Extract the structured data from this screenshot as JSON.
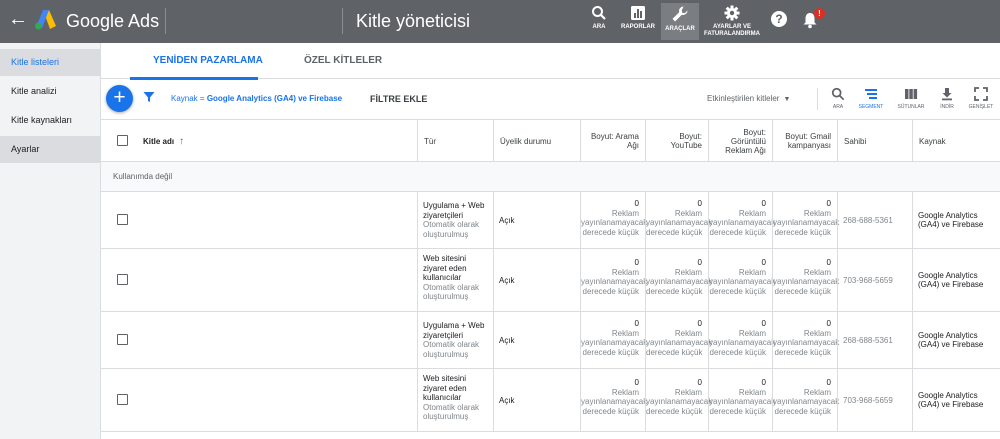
{
  "header": {
    "brand": "Google Ads",
    "page_title": "Kitle yöneticisi",
    "tools": [
      {
        "icon": "search-icon",
        "label": "ARA"
      },
      {
        "icon": "reports-icon",
        "label": "RAPORLAR"
      },
      {
        "icon": "wrench-icon",
        "label": "ARAÇLAR"
      },
      {
        "icon": "settings-icon",
        "label": "AYARLAR VE FATURALANDIRMA"
      }
    ],
    "notification_badge": "!"
  },
  "sidebar": {
    "items": [
      {
        "label": "Kitle listeleri"
      },
      {
        "label": "Kitle analizi"
      },
      {
        "label": "Kitle kaynakları"
      },
      {
        "label": "Ayarlar"
      }
    ]
  },
  "tabs": [
    {
      "label": "YENİDEN PAZARLAMA"
    },
    {
      "label": "ÖZEL KİTLELER"
    }
  ],
  "toolbar": {
    "fab": "+",
    "filter_prefix": "Kaynak = ",
    "filter_value": "Google Analytics (GA4) ve Firebase",
    "add_filter": "FİLTRE EKLE",
    "active_dropdown": "Etkinleştirilen kitleler",
    "icons": [
      {
        "icon": "search-icon",
        "label": "ARA"
      },
      {
        "icon": "segment-icon",
        "label": "SEGMENT"
      },
      {
        "icon": "columns-icon",
        "label": "SÜTUNLAR"
      },
      {
        "icon": "download-icon",
        "label": "İNDİR"
      },
      {
        "icon": "expand-icon",
        "label": "GENİŞLET"
      }
    ]
  },
  "table": {
    "columns": {
      "name": "Kitle adı",
      "type": "Tür",
      "membership": "Üyelik durumu",
      "search": "Boyut: Arama Ağı",
      "youtube": "Boyut: YouTube",
      "display": "Boyut: Görüntülü Reklam Ağı",
      "gmail": "Boyut: Gmail kampanyası",
      "owner": "Sahibi",
      "source": "Kaynak"
    },
    "group_label": "Kullanımda değil",
    "rows": [
      {
        "type": "Uygulama + Web ziyaretçileri",
        "type_sub": "Otomatik olarak oluşturulmuş",
        "membership": "Açık",
        "size_value": "0",
        "size_sub1": "Reklam",
        "size_sub2": "yayınlanamayacak",
        "size_sub3": "derecede küçük",
        "owner": "268-688-5361",
        "source": "Google Analytics (GA4) ve Firebase"
      },
      {
        "type": "Web sitesini ziyaret eden kullanıcılar",
        "type_sub": "Otomatik olarak oluşturulmuş",
        "membership": "Açık",
        "size_value": "0",
        "size_sub1": "Reklam",
        "size_sub2": "yayınlanamayacak",
        "size_sub3": "derecede küçük",
        "owner": "703-968-5659",
        "source": "Google Analytics (GA4) ve Firebase"
      },
      {
        "type": "Uygulama + Web ziyaretçileri",
        "type_sub": "Otomatik olarak oluşturulmuş",
        "membership": "Açık",
        "size_value": "0",
        "size_sub1": "Reklam",
        "size_sub2": "yayınlanamayacak",
        "size_sub3": "derecede küçük",
        "owner": "268-688-5361",
        "source": "Google Analytics (GA4) ve Firebase"
      },
      {
        "type": "Web sitesini ziyaret eden kullanıcılar",
        "type_sub": "Otomatik olarak oluşturulmuş",
        "membership": "Açık",
        "size_value": "0",
        "size_sub1": "Reklam",
        "size_sub2": "yayınlanamayacak",
        "size_sub3": "derecede küçük",
        "owner": "703-968-5659",
        "source": "Google Analytics (GA4) ve Firebase"
      }
    ]
  }
}
